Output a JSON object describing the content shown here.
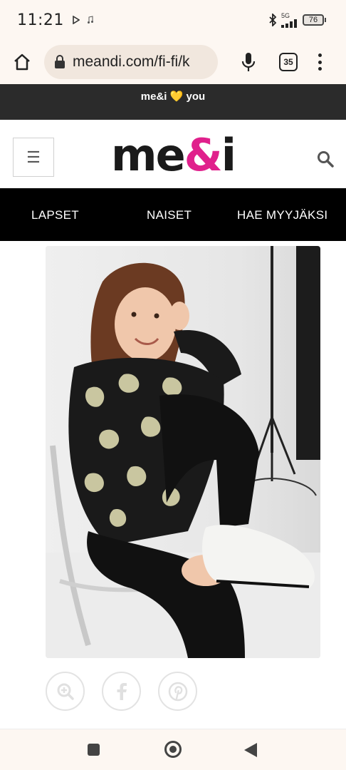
{
  "status_bar": {
    "time": "11:21",
    "network": "5G",
    "battery": "76"
  },
  "browser": {
    "url": "meandi.com/fi-fi/k",
    "tab_count": "35"
  },
  "promo": {
    "text_before": "me&i",
    "heart": "💛",
    "text_after": "you"
  },
  "header": {
    "hamburger": "☰",
    "logo_part1": "me",
    "logo_amp": "&",
    "logo_part2": "i"
  },
  "nav": {
    "items": [
      "LAPSET",
      "NAISET",
      "HAE MYYJÄKSI"
    ]
  },
  "product": {
    "image_icon": "photo-girl-in-printed-sweatshirt"
  },
  "share": {
    "icons": [
      "zoom-in-icon",
      "facebook-icon",
      "pinterest-icon"
    ]
  },
  "colors": {
    "brand_pink": "#e0208c",
    "promo_bg": "#2b2b2b",
    "nav_bg": "#000000",
    "chrome_bg": "#fdf7f2"
  }
}
